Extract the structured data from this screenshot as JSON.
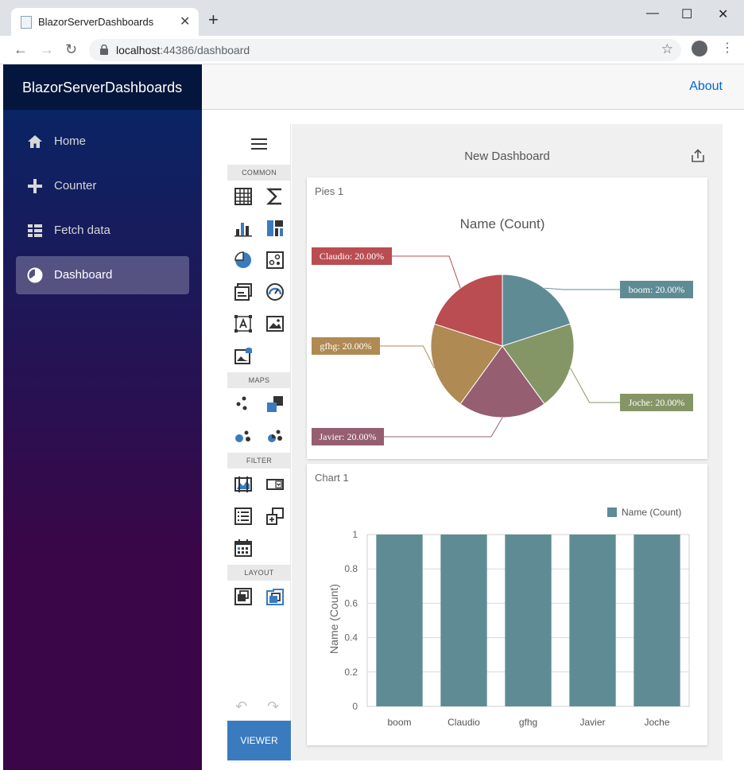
{
  "browser": {
    "tab_title": "BlazorServerDashboards",
    "url_host": "localhost",
    "url_rest": ":44386/dashboard"
  },
  "app": {
    "brand": "BlazorServerDashboards",
    "top_link": "About",
    "nav": [
      {
        "label": "Home",
        "icon": "home-icon",
        "active": false
      },
      {
        "label": "Counter",
        "icon": "plus-icon",
        "active": false
      },
      {
        "label": "Fetch data",
        "icon": "list-icon",
        "active": false
      },
      {
        "label": "Dashboard",
        "icon": "pie-icon",
        "active": true
      }
    ]
  },
  "toolbox": {
    "sections": [
      "COMMON",
      "MAPS",
      "FILTER",
      "LAYOUT"
    ],
    "viewer_label": "VIEWER"
  },
  "dashboard": {
    "title": "New Dashboard",
    "colors": {
      "boom": "#5f8b95",
      "Claudio": "#ba4d51",
      "gfhg": "#af8a53",
      "Javier": "#955f71",
      "Joche": "#859666"
    }
  },
  "pie_card": {
    "caption": "Pies 1",
    "chart_data": {
      "type": "pie",
      "title": "Name (Count)",
      "slices": [
        {
          "name": "boom",
          "value": 20.0,
          "label": "boom: 20.00%"
        },
        {
          "name": "Joche",
          "value": 20.0,
          "label": "Joche: 20.00%"
        },
        {
          "name": "Javier",
          "value": 20.0,
          "label": "Javier: 20.00%"
        },
        {
          "name": "gfhg",
          "value": 20.0,
          "label": "gfhg: 20.00%"
        },
        {
          "name": "Claudio",
          "value": 20.0,
          "label": "Claudio: 20.00%"
        }
      ]
    }
  },
  "bar_card": {
    "caption": "Chart 1",
    "chart_data": {
      "type": "bar",
      "categories": [
        "boom",
        "Claudio",
        "gfhg",
        "Javier",
        "Joche"
      ],
      "series": [
        {
          "name": "Name (Count)",
          "values": [
            1,
            1,
            1,
            1,
            1
          ]
        }
      ],
      "ylabel": "Name (Count)",
      "ylim": [
        0,
        1
      ],
      "yticks": [
        "0",
        "0.2",
        "0.4",
        "0.6",
        "0.8",
        "1"
      ],
      "grid": true,
      "legend": "top-right"
    }
  }
}
